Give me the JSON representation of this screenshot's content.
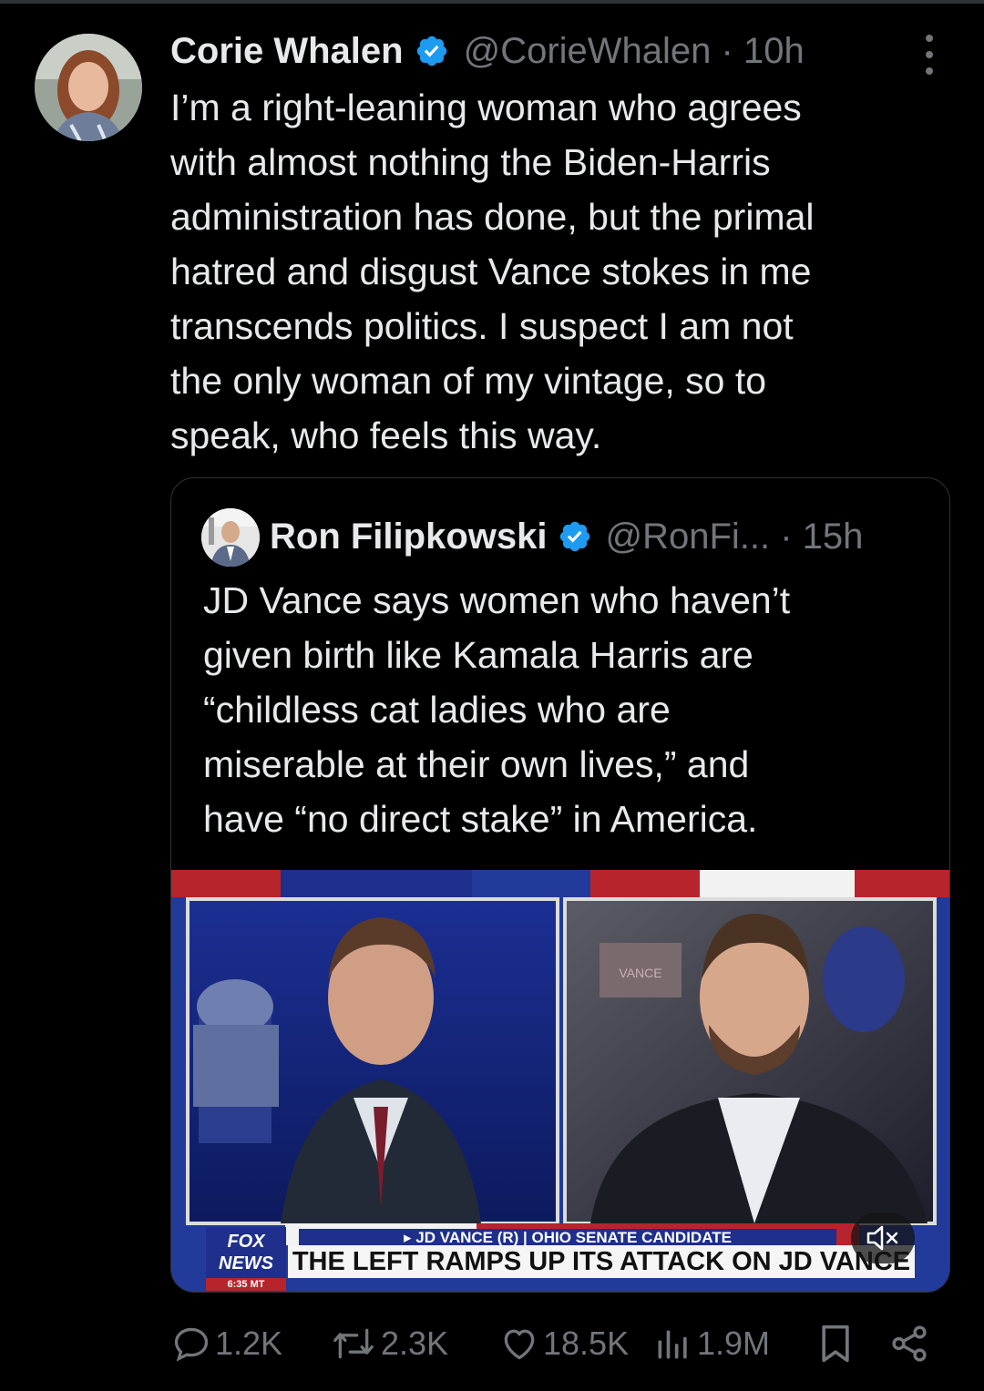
{
  "tweet": {
    "author_name": "Corie Whalen",
    "handle_time": "@CorieWhalen · 10h",
    "text": "I’m a right-leaning woman who agrees\nwith almost nothing the Biden-Harris\nadministration has done, but the primal\nhatred and disgust Vance stokes in me\ntranscends politics. I suspect I am not\nthe only woman of my vintage, so to\nspeak, who feels this way."
  },
  "quoted": {
    "author_name": "Ron Filipkowski",
    "handle_time": "@RonFi...  · 15h",
    "text": "JD Vance says women who haven’t\ngiven birth like Kamala Harris are\n“childless cat ladies who are\nmiserable at their own lives,” and\nhave “no direct stake” in America.",
    "video": {
      "logo_top": "FOX",
      "logo_bottom": "NEWS",
      "time": "6:35 MT",
      "lower_third_top": "▸ JD VANCE (R) | OHIO SENATE CANDIDATE",
      "lower_third_main": "THE LEFT RAMPS UP ITS ATTACK ON JD VANCE",
      "sign_text": "VANCE",
      "muted": true
    }
  },
  "actions": {
    "replies": "1.2K",
    "retweets": "2.3K",
    "likes": "18.5K",
    "views": "1.9M"
  },
  "colors": {
    "background": "#000000",
    "text": "#e7e9ea",
    "muted_text": "#71767b",
    "verified_blue": "#1d9bf0",
    "border": "#2f3336"
  }
}
